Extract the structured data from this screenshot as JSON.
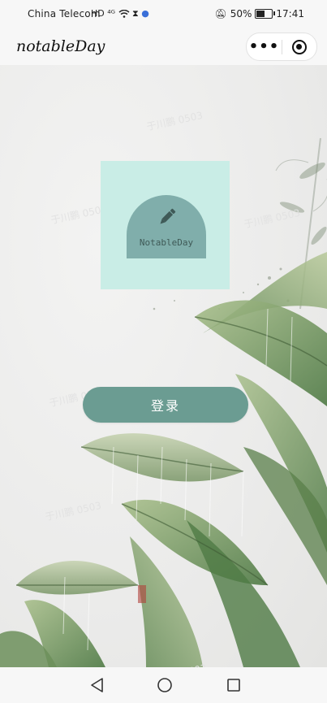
{
  "status_bar": {
    "carrier": "China Telecom",
    "signal_text": "HD ⁴ᴳ",
    "battery_percent": "50%",
    "battery_level": 0.5,
    "time": "17:41"
  },
  "title_bar": {
    "title": "notableDay",
    "more_icon": "more-dots-icon",
    "close_icon": "target-close-icon"
  },
  "logo": {
    "text": "NotableDay",
    "icon": "pencil-icon",
    "bg_color": "#c9ede6",
    "arch_color": "#80aeab"
  },
  "login": {
    "label": "登录",
    "color": "#6b9c92"
  },
  "watermarks": [
    "于川鹏 0503",
    "于川鹏 0503",
    "于川鹏 0503",
    "于川鹏 0503",
    "于川鹏 0503",
    "于川鹏 0503"
  ],
  "nav_bar": {
    "back_icon": "back-triangle-icon",
    "home_icon": "home-circle-icon",
    "recent_icon": "recent-square-icon"
  }
}
